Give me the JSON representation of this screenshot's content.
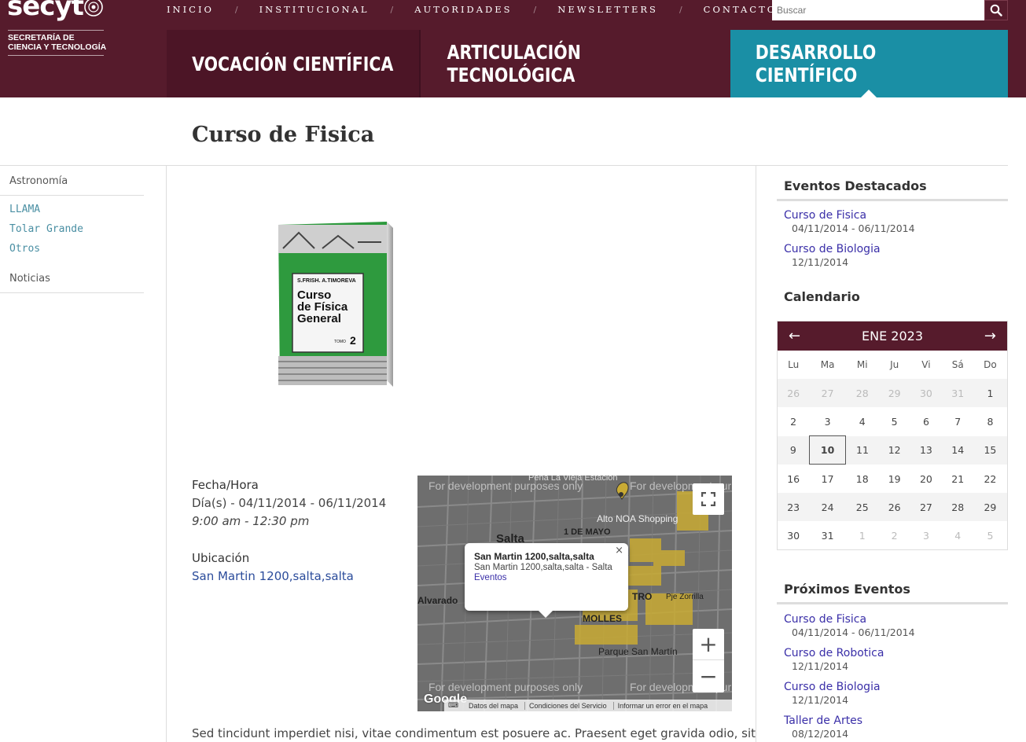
{
  "brand": {
    "logo": "secyt",
    "subtitle_line1": "SECRETARÍA DE",
    "subtitle_line2": "CIENCIA Y TECNOLOGÍA"
  },
  "topnav": [
    "INICIO",
    "INSTITUCIONAL",
    "AUTORIDADES",
    "NEWSLETTERS",
    "CONTACTO"
  ],
  "search": {
    "placeholder": "Buscar"
  },
  "mainnav": [
    "VOCACIÓN CIENTÍFICA",
    "ARTICULACIÓN TECNOLÓGICA",
    "DESARROLLO CIENTÍFICO"
  ],
  "page": {
    "title": "Curso de Fisica"
  },
  "sidebar": {
    "category1": "Astronomía",
    "links": [
      "LLAMA",
      "Tolar Grande",
      "Otros"
    ],
    "category2": "Noticias"
  },
  "book": {
    "authors": "S.FRISH.  A.TIMOREVA",
    "title1": "Curso",
    "title2": "de Física",
    "title3": "General",
    "tomo_label": "TOMO",
    "tomo_num": "2"
  },
  "event": {
    "date_heading": "Fecha/Hora",
    "dates": "Día(s) - 04/11/2014 - 06/11/2014",
    "time": "9:00 am - 12:30 pm",
    "location_heading": "Ubicación",
    "location": "San Martin 1200,salta,salta"
  },
  "map": {
    "dev_watermark": "For development purposes only",
    "popup_title": "San Martin 1200,salta,salta",
    "popup_address": "San Martin 1200,salta,salta - Salta",
    "popup_link": "Eventos",
    "labels": {
      "pena": "Peña La Vieja Estación",
      "alto": "Alto NOA Shopping",
      "salta": "Salta",
      "mayo": "1 DE MAYO",
      "alvarado": "Alvarado",
      "molles": "MOLLES",
      "centro": "TRO",
      "parque": "Parque San Martín",
      "pje": "Pje Zorrilla"
    },
    "footer": [
      "Datos del mapa",
      "Condiciones del Servicio",
      "Informar un error en el mapa"
    ],
    "google": "Google",
    "zoom_in": "+",
    "zoom_out": "−"
  },
  "body_text": "Sed tincidunt imperdiet nisi, vitae condimentum est posuere ac. Praesent eget gravida odio, sit",
  "featured": {
    "title": "Eventos Destacados",
    "items": [
      {
        "title": "Curso de Fisica",
        "date": "04/11/2014 - 06/11/2014"
      },
      {
        "title": "Curso de Biologia",
        "date": "12/11/2014"
      }
    ]
  },
  "calendar": {
    "title": "Calendario",
    "month": "ENE 2023",
    "days": [
      "Lu",
      "Ma",
      "Mi",
      "Ju",
      "Vi",
      "Sá",
      "Do"
    ],
    "weeks": [
      [
        "26",
        "27",
        "28",
        "29",
        "30",
        "31",
        "1"
      ],
      [
        "2",
        "3",
        "4",
        "5",
        "6",
        "7",
        "8"
      ],
      [
        "9",
        "10",
        "11",
        "12",
        "13",
        "14",
        "15"
      ],
      [
        "16",
        "17",
        "18",
        "19",
        "20",
        "21",
        "22"
      ],
      [
        "23",
        "24",
        "25",
        "26",
        "27",
        "28",
        "29"
      ],
      [
        "30",
        "31",
        "1",
        "2",
        "3",
        "4",
        "5"
      ]
    ]
  },
  "upcoming": {
    "title": "Próximos Eventos",
    "items": [
      {
        "title": "Curso de Fisica",
        "date": "04/11/2014 - 06/11/2014"
      },
      {
        "title": "Curso de Robotica",
        "date": "12/11/2014"
      },
      {
        "title": "Curso de Biologia",
        "date": "12/11/2014"
      },
      {
        "title": "Taller de Artes",
        "date": "08/12/2014"
      }
    ]
  }
}
